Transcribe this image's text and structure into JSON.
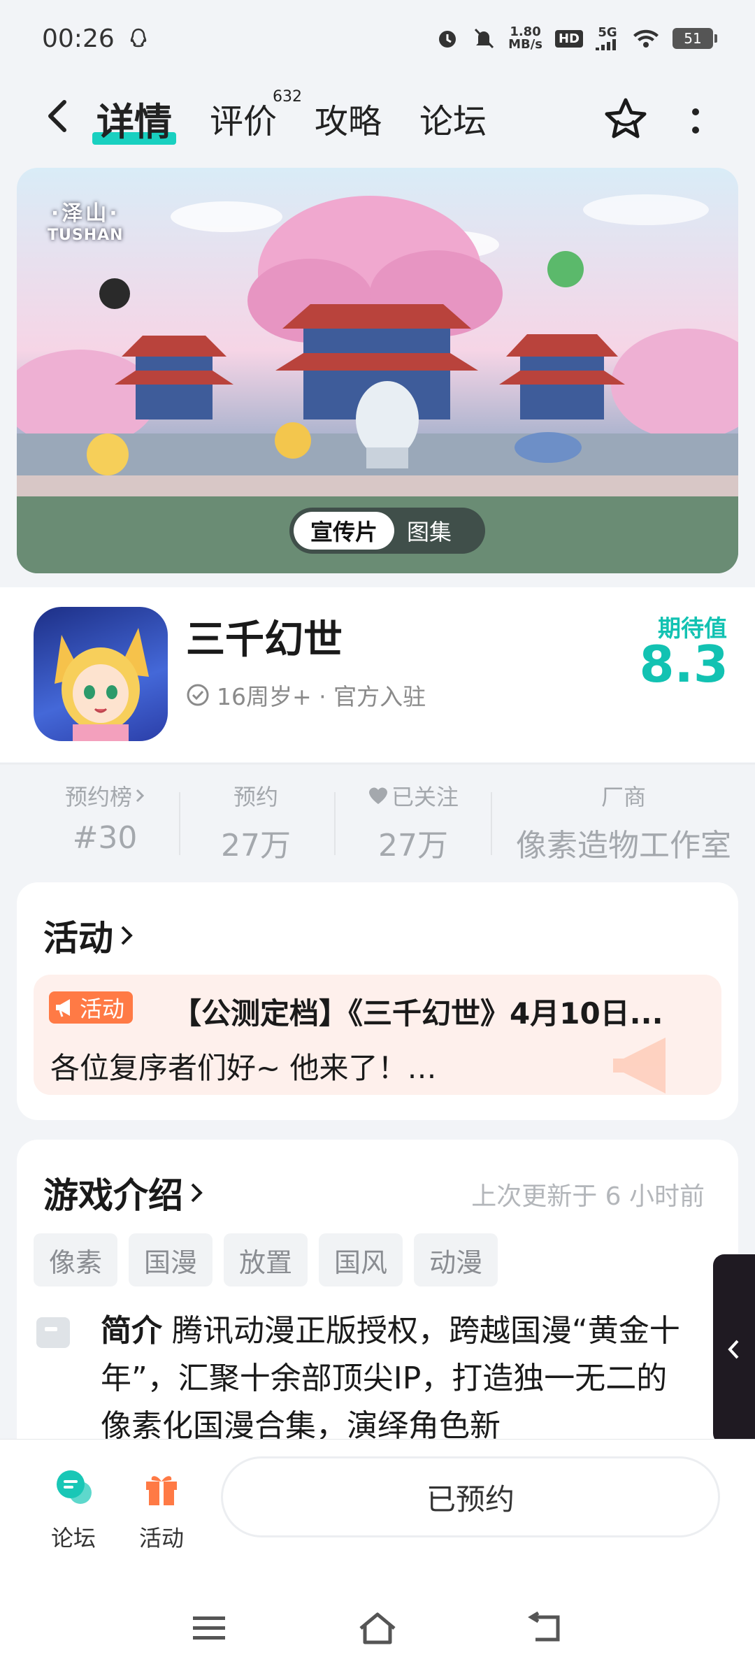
{
  "status": {
    "time": "00:26",
    "net_speed_value": "1.80",
    "net_speed_unit": "MB/s",
    "hd": "HD",
    "network": "5G",
    "battery": "51"
  },
  "nav": {
    "tabs": [
      {
        "label": "详情"
      },
      {
        "label": "评价",
        "badge": "632"
      },
      {
        "label": "攻略"
      },
      {
        "label": "论坛"
      }
    ]
  },
  "banner": {
    "logo_line1": "·泽山·",
    "logo_line2": "TUSHAN",
    "toggle_active": "宣传片",
    "toggle_other": "图集"
  },
  "app": {
    "name": "三千幻世",
    "meta": "16周岁+ · 官方入驻",
    "expect_label": "期待值",
    "expect_value": "8.3"
  },
  "stats": [
    {
      "label": "预约榜",
      "value": "#30"
    },
    {
      "label": "预约",
      "value": "27万"
    },
    {
      "label": "已关注",
      "value": "27万"
    },
    {
      "label": "厂商",
      "value": "像素造物工作室"
    }
  ],
  "activity": {
    "title": "活动",
    "badge": "活动",
    "item_title": "【公测定档】《三千幻世》4月10日...",
    "item_desc": "各位复序者们好~ 他来了！他来了！大家..."
  },
  "intro": {
    "title": "游戏介绍",
    "updated": "上次更新于 6 小时前",
    "tags": [
      "像素",
      "国漫",
      "放置",
      "国风",
      "动漫"
    ],
    "label": "简介",
    "text": " 腾讯动漫正版授权，跨越国漫“黄金十年”，汇聚十余部顶尖IP，打造独一无二的像素化国漫合集，演绎角色新"
  },
  "bottom": {
    "forum_label": "论坛",
    "activity_label": "活动",
    "reserve_label": "已预约"
  },
  "colors": {
    "accent": "#12c2b2",
    "activity_orange": "#ff7a45"
  }
}
